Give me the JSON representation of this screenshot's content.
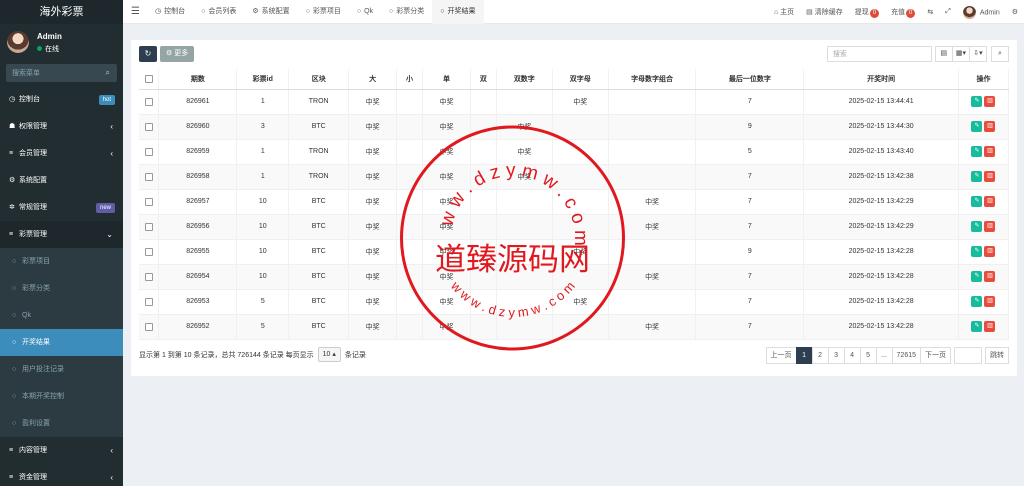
{
  "app": {
    "title": "海外彩票"
  },
  "user": {
    "name": "Admin",
    "status": "在线"
  },
  "sidebar": {
    "search_placeholder": "搜索菜单",
    "items": [
      {
        "label": "控制台",
        "icon": "dashboard-icon",
        "badge": "hot",
        "badge_color": "#3c8dbc"
      },
      {
        "label": "权限管理",
        "icon": "group-icon",
        "arrow": "‹"
      },
      {
        "label": "会员管理",
        "icon": "list-icon",
        "arrow": "‹"
      },
      {
        "label": "系统配置",
        "icon": "gear-icon"
      },
      {
        "label": "常规管理",
        "icon": "cogs-icon",
        "badge": "new",
        "badge_color": "#605ca8"
      },
      {
        "label": "彩票管理",
        "icon": "list-icon",
        "arrow": "⌄"
      }
    ],
    "sub_items": [
      "彩票项目",
      "彩票分类",
      "Qk",
      "开奖结果",
      "用户投注记录",
      "本期开奖控制",
      "盈利设置"
    ],
    "bottom_items": [
      {
        "label": "内容管理",
        "icon": "list-icon",
        "arrow": "‹"
      },
      {
        "label": "资金管理",
        "icon": "list-icon",
        "arrow": "‹"
      }
    ]
  },
  "topbar": {
    "tabs": [
      "控制台",
      "会员列表",
      "系统配置",
      "彩票项目",
      "Qk",
      "彩票分类",
      "开奖结果"
    ],
    "home": "主页",
    "clear_cache": "清除缓存",
    "withdraw": "提现",
    "withdraw_count": "0",
    "recharge": "充值",
    "recharge_count": "0",
    "admin": "Admin"
  },
  "toolbar": {
    "more_label": "更多",
    "search_placeholder": "搜索"
  },
  "table": {
    "headers": [
      "期数",
      "彩票id",
      "区块",
      "大",
      "小",
      "单",
      "双",
      "双数字",
      "双字母",
      "字母数字组合",
      "最后一位数字",
      "开奖时间",
      "操作"
    ],
    "rows": [
      [
        "826961",
        "1",
        "TRON",
        "中奖",
        "",
        "中奖",
        "",
        "",
        "中奖",
        "",
        "7",
        "2025-02-15 13:44:41"
      ],
      [
        "826960",
        "3",
        "BTC",
        "中奖",
        "",
        "中奖",
        "",
        "中奖",
        "",
        "",
        "9",
        "2025-02-15 13:44:30"
      ],
      [
        "826959",
        "1",
        "TRON",
        "中奖",
        "",
        "中奖",
        "",
        "中奖",
        "",
        "",
        "5",
        "2025-02-15 13:43:40"
      ],
      [
        "826958",
        "1",
        "TRON",
        "中奖",
        "",
        "中奖",
        "",
        "中奖",
        "",
        "",
        "7",
        "2025-02-15 13:42:38"
      ],
      [
        "826957",
        "10",
        "BTC",
        "中奖",
        "",
        "中奖",
        "",
        "",
        "",
        "中奖",
        "7",
        "2025-02-15 13:42:29"
      ],
      [
        "826956",
        "10",
        "BTC",
        "中奖",
        "",
        "中奖",
        "",
        "",
        "",
        "中奖",
        "7",
        "2025-02-15 13:42:29"
      ],
      [
        "826955",
        "10",
        "BTC",
        "中奖",
        "",
        "中奖",
        "",
        "",
        "中奖",
        "",
        "9",
        "2025-02-15 13:42:28"
      ],
      [
        "826954",
        "10",
        "BTC",
        "中奖",
        "",
        "中奖",
        "",
        "",
        "",
        "中奖",
        "7",
        "2025-02-15 13:42:28"
      ],
      [
        "826953",
        "5",
        "BTC",
        "中奖",
        "",
        "中奖",
        "",
        "",
        "中奖",
        "",
        "7",
        "2025-02-15 13:42:28"
      ],
      [
        "826952",
        "5",
        "BTC",
        "中奖",
        "",
        "中奖",
        "",
        "",
        "",
        "中奖",
        "7",
        "2025-02-15 13:42:28"
      ]
    ]
  },
  "footer": {
    "info": "显示第 1 到第 10 条记录，总共 726144 条记录 每页显示",
    "page_size": "10",
    "suffix": "条记录"
  },
  "pager": {
    "prev": "上一页",
    "pages": [
      "1",
      "2",
      "3",
      "4",
      "5",
      "...",
      "72615"
    ],
    "next": "下一页",
    "go": "跳转"
  },
  "watermark": {
    "text": "道臻源码网",
    "ring": "www.dzymw.com",
    "color": "#e0191e"
  }
}
